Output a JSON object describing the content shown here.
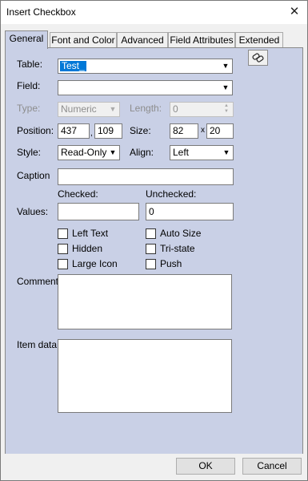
{
  "window": {
    "title": "Insert Checkbox",
    "close_glyph": "✕"
  },
  "tabs": [
    {
      "label": "General",
      "active": true
    },
    {
      "label": "Font and Color",
      "active": false
    },
    {
      "label": "Advanced",
      "active": false
    },
    {
      "label": "Field Attributes",
      "active": false
    },
    {
      "label": "Extended",
      "active": false
    }
  ],
  "form": {
    "table_label": "Table:",
    "table_value": "Test_",
    "field_label": "Field:",
    "field_value": "",
    "type_label": "Type:",
    "type_value": "Numeric",
    "length_label": "Length:",
    "length_value": "0",
    "position_label": "Position:",
    "position_x": "437",
    "position_sep": ",",
    "position_y": "109",
    "size_label": "Size:",
    "size_w": "82",
    "size_sep": "x",
    "size_h": "20",
    "style_label": "Style:",
    "style_value": "Read-Only",
    "align_label": "Align:",
    "align_value": "Left",
    "caption_label": "Caption",
    "caption_value": "",
    "checked_label": "Checked:",
    "unchecked_label": "Unchecked:",
    "values_label": "Values:",
    "checked_value": "",
    "unchecked_value": "0",
    "options": {
      "left_text": "Left Text",
      "auto_size": "Auto Size",
      "hidden": "Hidden",
      "tri_state": "Tri-state",
      "large_icon": "Large Icon",
      "push": "Push"
    },
    "comment_label": "Comment:",
    "item_data_label": "Item data:"
  },
  "footer": {
    "ok_label": "OK",
    "cancel_label": "Cancel"
  },
  "colors": {
    "panel": "#c9d0e6",
    "selection": "#0078d7",
    "dialog": "#f0f0f0"
  },
  "icons": {
    "field_picker": "link-icon",
    "dropdown": "chevron-down-icon"
  }
}
